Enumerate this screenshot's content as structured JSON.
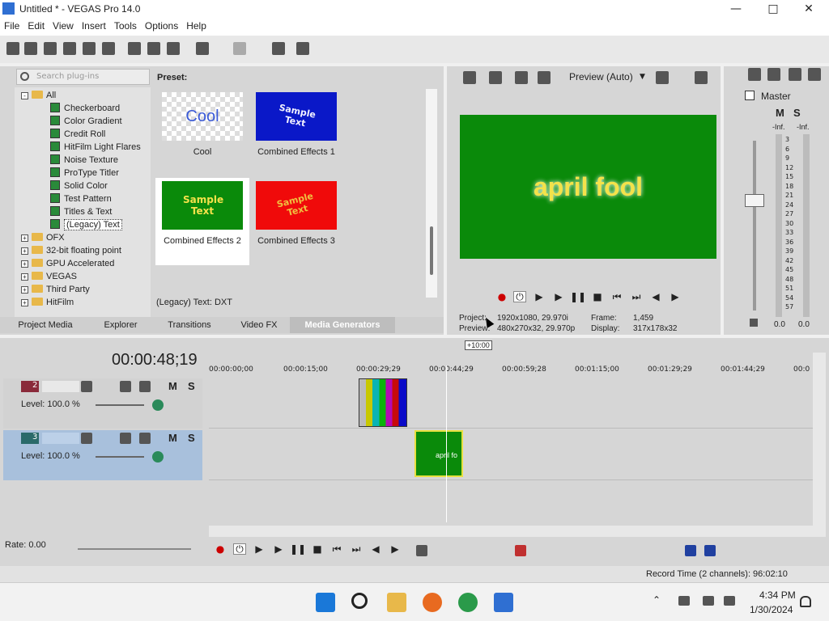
{
  "window": {
    "title": "Untitled * - VEGAS Pro 14.0"
  },
  "menu": [
    "File",
    "Edit",
    "View",
    "Insert",
    "Tools",
    "Options",
    "Help"
  ],
  "plugins": {
    "search_placeholder": "Search plug-ins",
    "tree": [
      {
        "label": "All",
        "level": 1,
        "type": "folder",
        "expanded": true
      },
      {
        "label": "Checkerboard",
        "level": 2,
        "type": "plugin"
      },
      {
        "label": "Color Gradient",
        "level": 2,
        "type": "plugin"
      },
      {
        "label": "Credit Roll",
        "level": 2,
        "type": "plugin"
      },
      {
        "label": "HitFilm Light Flares",
        "level": 2,
        "type": "plugin"
      },
      {
        "label": "Noise Texture",
        "level": 2,
        "type": "plugin"
      },
      {
        "label": "ProType Titler",
        "level": 2,
        "type": "plugin"
      },
      {
        "label": "Solid Color",
        "level": 2,
        "type": "plugin"
      },
      {
        "label": "Test Pattern",
        "level": 2,
        "type": "plugin"
      },
      {
        "label": "Titles & Text",
        "level": 2,
        "type": "plugin"
      },
      {
        "label": "(Legacy) Text",
        "level": 2,
        "type": "plugin",
        "selected": true
      },
      {
        "label": "OFX",
        "level": 0,
        "type": "folder"
      },
      {
        "label": "32-bit floating point",
        "level": 0,
        "type": "folder"
      },
      {
        "label": "GPU Accelerated",
        "level": 0,
        "type": "folder"
      },
      {
        "label": "VEGAS",
        "level": 0,
        "type": "folder"
      },
      {
        "label": "Third Party",
        "level": 0,
        "type": "folder"
      },
      {
        "label": "HitFilm",
        "level": 0,
        "type": "folder"
      }
    ],
    "preset_label": "Preset:",
    "presets": [
      {
        "name": "Cool",
        "thumb_text": "Cool",
        "bg": "#cccccc",
        "fg": "#3a5ad8"
      },
      {
        "name": "Combined Effects 1",
        "thumb_text": "Sample Text",
        "bg": "#0a18c8",
        "fg": "#f0f0ff"
      },
      {
        "name": "Combined Effects 2",
        "thumb_text": "Sample Text",
        "bg": "#0a8a0a",
        "fg": "#f4e24a",
        "selected": true
      },
      {
        "name": "Combined Effects 3",
        "thumb_text": "Sample Text",
        "bg": "#f00a0a",
        "fg": "#f0c040"
      }
    ],
    "status": "(Legacy) Text: DXT",
    "tabs": [
      "Project Media",
      "Explorer",
      "Transitions",
      "Video FX",
      "Media Generators"
    ],
    "active_tab": "Media Generators"
  },
  "preview": {
    "mode": "Preview (Auto)",
    "text": "april fool",
    "bg_color": "#0a8a0a",
    "project_label": "Project:",
    "project_value": "1920x1080, 29.970i",
    "preview_label": "Preview:",
    "preview_value": "480x270x32, 29.970p",
    "frame_label": "Frame:",
    "frame_value": "1,459",
    "display_label": "Display:",
    "display_value": "317x178x32"
  },
  "master": {
    "label": "Master",
    "m": "M",
    "s": "S",
    "inf_left": "-Inf.",
    "inf_right": "-Inf.",
    "scale": [
      "3",
      "6",
      "9",
      "12",
      "15",
      "18",
      "21",
      "24",
      "27",
      "30",
      "33",
      "36",
      "39",
      "42",
      "45",
      "48",
      "51",
      "54",
      "57"
    ],
    "level_left": "0.0",
    "level_right": "0.0"
  },
  "timeline": {
    "timecode": "00:00:48;19",
    "offset_label": "+10:00",
    "ruler": [
      "00:00:00;00",
      "00:00:15;00",
      "00:00:29;29",
      "00:00:44;29",
      "00:00:59;28",
      "00:01:15;00",
      "00:01:29;29",
      "00:01:44;29",
      "00:0"
    ],
    "tracks": [
      {
        "num": "2",
        "level": "Level: 100.0 %",
        "m": "M",
        "s": "S",
        "color": "#8a2a3a"
      },
      {
        "num": "3",
        "level": "Level: 100.0 %",
        "m": "M",
        "s": "S",
        "color": "#2a6a6a",
        "selected": true
      }
    ],
    "clip_text": "april fo",
    "rate": "Rate: 0.00",
    "record_time": "Record Time (2 channels): 96:02:10"
  },
  "taskbar": {
    "time": "4:34 PM",
    "date": "1/30/2024"
  }
}
